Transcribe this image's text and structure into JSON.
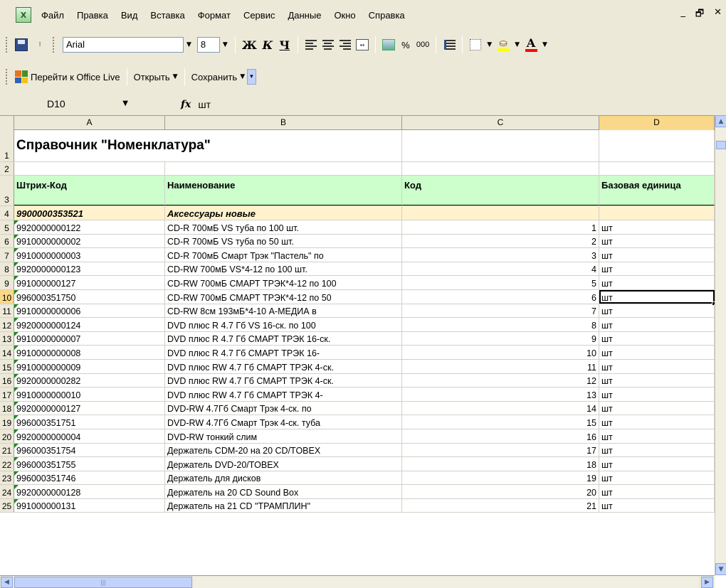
{
  "menu": {
    "items": [
      "Файл",
      "Правка",
      "Вид",
      "Вставка",
      "Формат",
      "Сервис",
      "Данные",
      "Окно",
      "Справка"
    ],
    "minimize": "_",
    "restore": "🗗",
    "close": "✕"
  },
  "formatting": {
    "font_name": "Arial",
    "font_size": "8",
    "bold": "Ж",
    "italic": "К",
    "underline": "Ч",
    "percent": "%",
    "thousands": "000",
    "font_color_letter": "А",
    "fill_color": "#ffff00",
    "font_color": "#ff0000"
  },
  "office_live": {
    "goto_label": "Перейти к Office Live",
    "open_label": "Открыть",
    "save_label": "Сохранить"
  },
  "formula_bar": {
    "name_box": "D10",
    "fx": "fx",
    "value": "шт"
  },
  "sheet": {
    "columns": [
      "A",
      "B",
      "C",
      "D"
    ],
    "active_column": "D",
    "active_row": "10",
    "title": "Справочник \"Номенклатура\"",
    "headers": {
      "a": "Штрих-Код",
      "b": "Наименование",
      "c": "Код",
      "d": "Базовая единица"
    },
    "group": {
      "code": "9900000353521",
      "name": "Аксессуары новые"
    },
    "rows": [
      {
        "n": "5",
        "code": "9920000000122",
        "name": "CD-R 700мБ VS туба по 100 шт.",
        "id": "1",
        "unit": "шт"
      },
      {
        "n": "6",
        "code": "9910000000002",
        "name": "CD-R 700мБ VS туба по 50 шт.",
        "id": "2",
        "unit": "шт"
      },
      {
        "n": "7",
        "code": "9910000000003",
        "name": "CD-R 700мБ Смарт Трэк \"Пастель\" по",
        "id": "3",
        "unit": "шт"
      },
      {
        "n": "8",
        "code": "9920000000123",
        "name": "CD-RW 700мБ VS*4-12 по 100 шт.",
        "id": "4",
        "unit": "шт"
      },
      {
        "n": "9",
        "code": "991000000127",
        "name": "CD-RW 700мБ СМАРТ ТРЭК*4-12 по 100",
        "id": "5",
        "unit": "шт"
      },
      {
        "n": "10",
        "code": "996000351750",
        "name": "CD-RW 700мБ СМАРТ ТРЭК*4-12 по 50",
        "id": "6",
        "unit": "шт"
      },
      {
        "n": "11",
        "code": "9910000000006",
        "name": "CD-RW 8см 193мБ*4-10 А-МЕДИА в",
        "id": "7",
        "unit": "шт"
      },
      {
        "n": "12",
        "code": "9920000000124",
        "name": "DVD плюс R 4.7 Гб  VS 16-ск. по 100",
        "id": "8",
        "unit": "шт"
      },
      {
        "n": "13",
        "code": "9910000000007",
        "name": "DVD плюс R 4.7 Гб СМАРТ ТРЭК 16-ск.",
        "id": "9",
        "unit": "шт"
      },
      {
        "n": "14",
        "code": "9910000000008",
        "name": "DVD плюс R 4.7 Гб СМАРТ ТРЭК 16-",
        "id": "10",
        "unit": "шт"
      },
      {
        "n": "15",
        "code": "9910000000009",
        "name": "DVD плюс RW 4.7 Гб СМАРТ ТРЭК 4-ск.",
        "id": "11",
        "unit": "шт"
      },
      {
        "n": "16",
        "code": "9920000000282",
        "name": "DVD плюс RW 4.7 Гб СМАРТ ТРЭК 4-ск.",
        "id": "12",
        "unit": "шт"
      },
      {
        "n": "17",
        "code": "9910000000010",
        "name": "DVD плюс RW 4.7 Гб СМАРТ ТРЭК 4-",
        "id": "13",
        "unit": "шт"
      },
      {
        "n": "18",
        "code": "9920000000127",
        "name": "DVD-RW 4.7Гб Смарт Трэк 4-ск. по",
        "id": "14",
        "unit": "шт"
      },
      {
        "n": "19",
        "code": "996000351751",
        "name": "DVD-RW 4.7Гб Смарт Трэк 4-ск. туба",
        "id": "15",
        "unit": "шт"
      },
      {
        "n": "20",
        "code": "9920000000004",
        "name": "DVD-RW тонкий слим",
        "id": "16",
        "unit": "шт"
      },
      {
        "n": "21",
        "code": "996000351754",
        "name": "Держатель CDM-20 на 20 CD/TOBEX",
        "id": "17",
        "unit": "шт"
      },
      {
        "n": "22",
        "code": "996000351755",
        "name": "Держатель DVD-20/TOBEX",
        "id": "18",
        "unit": "шт"
      },
      {
        "n": "23",
        "code": "996000351746",
        "name": "Держатель для дисков",
        "id": "19",
        "unit": "шт"
      },
      {
        "n": "24",
        "code": "9920000000128",
        "name": "Держатель на 20 CD Sound Box",
        "id": "20",
        "unit": "шт"
      },
      {
        "n": "25",
        "code": "991000000131",
        "name": "Держатель на 21 CD \"ТРАМПЛИН\"",
        "id": "21",
        "unit": "шт"
      }
    ]
  }
}
